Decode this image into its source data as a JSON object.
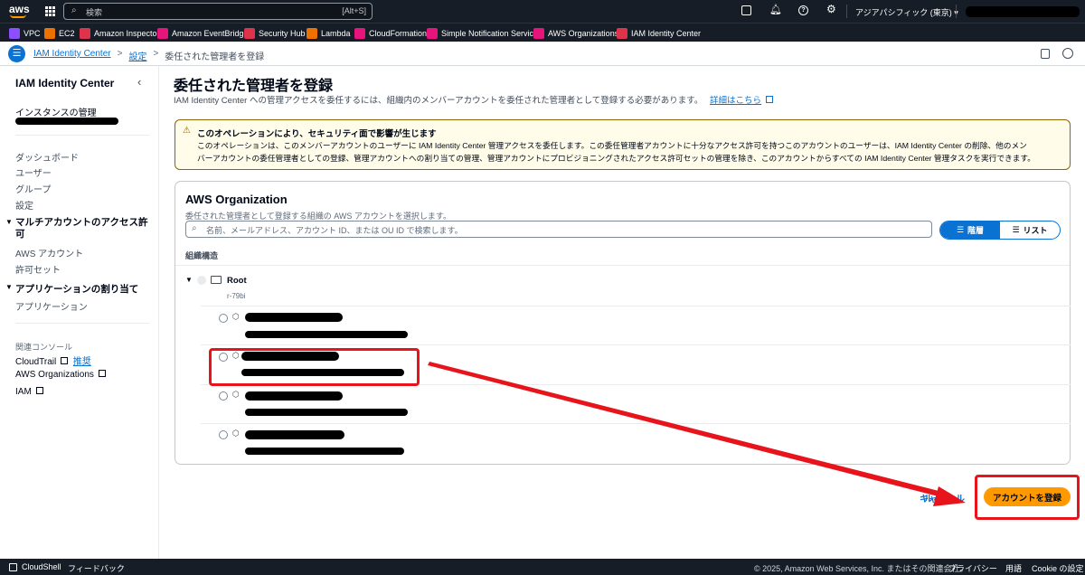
{
  "topnav": {
    "logo": "aws",
    "search_placeholder": "検索",
    "search_shortcut": "[Alt+S]",
    "region": "アジアパシフィック (東京) ▾"
  },
  "favorites": [
    {
      "label": "VPC",
      "color": "#8c4fff"
    },
    {
      "label": "EC2",
      "color": "#ed7100"
    },
    {
      "label": "Amazon Inspector",
      "color": "#dd344c"
    },
    {
      "label": "Amazon EventBridge",
      "color": "#e7157b"
    },
    {
      "label": "Security Hub",
      "color": "#dd344c"
    },
    {
      "label": "Lambda",
      "color": "#ed7100"
    },
    {
      "label": "CloudFormation",
      "color": "#e7157b"
    },
    {
      "label": "Simple Notification Service",
      "color": "#e7157b"
    },
    {
      "label": "AWS Organizations",
      "color": "#e7157b"
    },
    {
      "label": "IAM Identity Center",
      "color": "#dd344c"
    }
  ],
  "breadcrumb": {
    "item1": "IAM Identity Center",
    "sep": ">",
    "item2": "設定",
    "current": "委任された管理者を登録"
  },
  "sidebar": {
    "title": "IAM Identity Center",
    "instance_label": "インスタンスの管理",
    "items": [
      "ダッシュボード",
      "ユーザー",
      "グループ",
      "設定"
    ],
    "section1": "マルチアカウントのアクセス許可",
    "section1_items": [
      "AWS アカウント",
      "許可セット"
    ],
    "section2": "アプリケーションの割り当て",
    "section2_items": [
      "アプリケーション"
    ],
    "related_label": "関連コンソール",
    "cloudtrail": "CloudTrail",
    "recommended": "推奨",
    "organizations": "AWS Organizations",
    "iam": "IAM"
  },
  "main": {
    "title": "委任された管理者を登録",
    "description": "IAM Identity Center への管理アクセスを委任するには、組織内のメンバーアカウントを委任された管理者として登録する必要があります。",
    "learn_more": "詳細はこちら",
    "warning_title": "このオペレーションにより、セキュリティ面で影響が生じます",
    "warning_line1": "このオペレーションは、このメンバーアカウントのユーザーに IAM Identity Center 管理アクセスを委任します。この委任管理者アカウントに十分なアクセス許可を持つこのアカウントのユーザーは、IAM Identity Center の削除、他のメン",
    "warning_line2": "バーアカウントの委任管理者としての登録、管理アカウントへの割り当ての管理、管理アカウントにプロビジョニングされたアクセス許可セットの管理を除き、このアカウントからすべての IAM Identity Center 管理タスクを実行できます。",
    "org_title": "AWS Organization",
    "org_desc": "委任された管理者として登録する組織の AWS アカウントを選択します。",
    "search_placeholder": "名前、メールアドレス、アカウント ID、または OU ID で検索します。",
    "view_hierarchy": "階層",
    "view_list": "リスト",
    "tree_label": "組織構造",
    "root_name": "Root",
    "root_id": "r-79bi",
    "cancel": "キャンセル",
    "register_button": "アカウントを登録"
  },
  "footer": {
    "cloudshell": "CloudShell",
    "feedback": "フィードバック",
    "copyright": "© 2025, Amazon Web Services, Inc. またはその関連会社。",
    "privacy": "プライバシー",
    "terms": "用語",
    "cookie": "Cookie の設定"
  }
}
